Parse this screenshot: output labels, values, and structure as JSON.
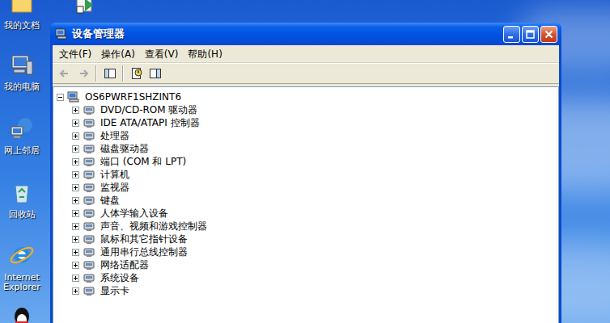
{
  "desktop": {
    "icons": [
      {
        "label": "我的文档",
        "kind": "documents"
      },
      {
        "label": "",
        "kind": "shortcut"
      },
      {
        "label": "我的电脑",
        "kind": "computer"
      },
      {
        "label": "网上邻居",
        "kind": "network"
      },
      {
        "label": "回收站",
        "kind": "recycle"
      },
      {
        "label": "Internet Explorer",
        "kind": "ie"
      },
      {
        "label": "",
        "kind": "qq"
      }
    ]
  },
  "window": {
    "title": "设备管理器"
  },
  "menu": [
    "文件(F)",
    "操作(A)",
    "查看(V)",
    "帮助(H)"
  ],
  "toolbar": [
    {
      "kind": "back",
      "disabled": true
    },
    {
      "kind": "forward",
      "disabled": true
    },
    {
      "kind": "separator",
      "disabled": false
    },
    {
      "kind": "tree",
      "disabled": false
    },
    {
      "kind": "separator",
      "disabled": false
    },
    {
      "kind": "properties",
      "disabled": false
    },
    {
      "kind": "view",
      "disabled": false
    }
  ],
  "tree": {
    "root": {
      "label": "OS6PWRF1SHZINT6",
      "expanded": true
    },
    "items": [
      {
        "label": "DVD/CD-ROM 驱动器",
        "expanded": false
      },
      {
        "label": "IDE ATA/ATAPI 控制器",
        "expanded": false
      },
      {
        "label": "处理器",
        "expanded": false
      },
      {
        "label": "磁盘驱动器",
        "expanded": false
      },
      {
        "label": "端口 (COM 和 LPT)",
        "expanded": false
      },
      {
        "label": "计算机",
        "expanded": false
      },
      {
        "label": "监视器",
        "expanded": false
      },
      {
        "label": "键盘",
        "expanded": false
      },
      {
        "label": "人体学输入设备",
        "expanded": false
      },
      {
        "label": "声音、视频和游戏控制器",
        "expanded": false
      },
      {
        "label": "鼠标和其它指针设备",
        "expanded": false
      },
      {
        "label": "通用串行总线控制器",
        "expanded": false
      },
      {
        "label": "网络适配器",
        "expanded": false
      },
      {
        "label": "系统设备",
        "expanded": false
      },
      {
        "label": "显示卡",
        "expanded": false
      }
    ]
  }
}
